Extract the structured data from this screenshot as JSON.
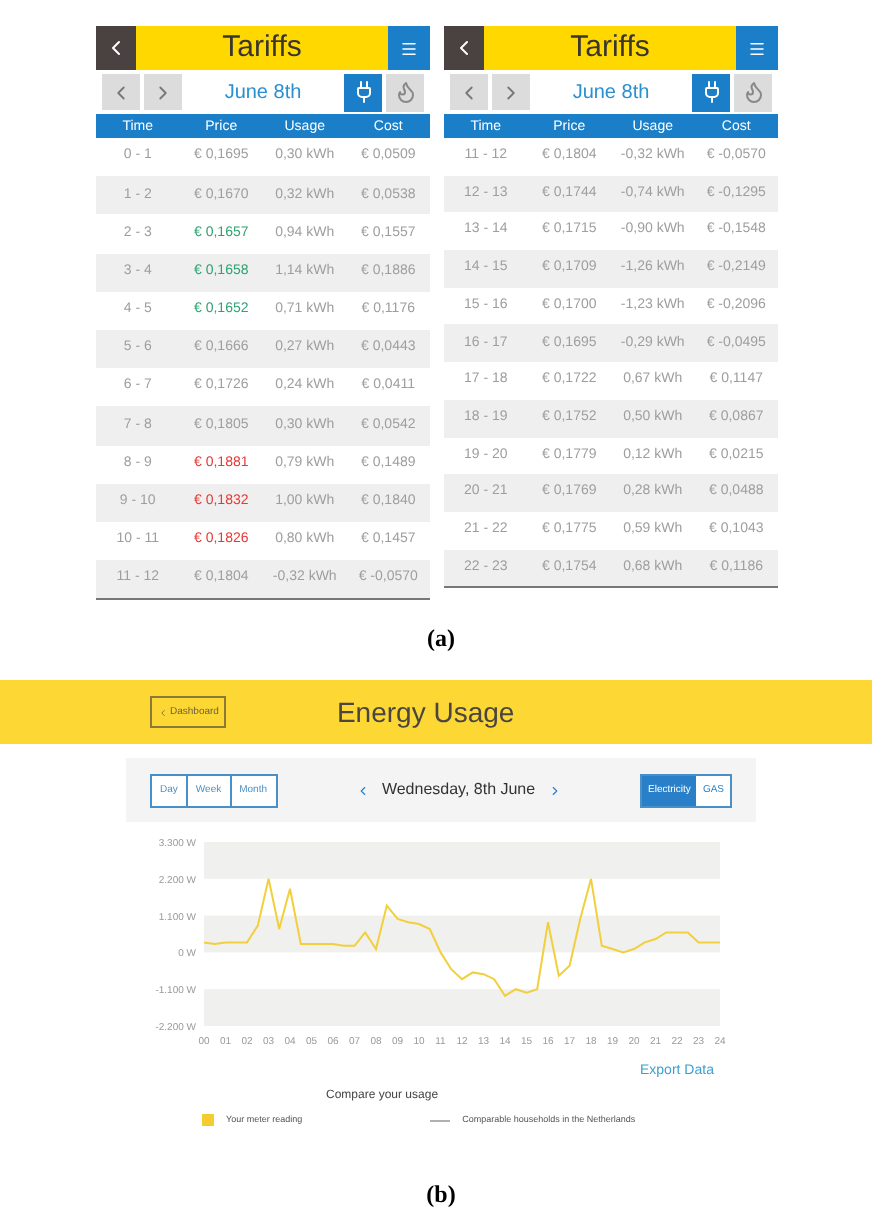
{
  "tariff_screens": [
    {
      "title": "Tariffs",
      "date": "June 8th",
      "energy_buttons": [
        {
          "kind": "electricity",
          "selected": true
        },
        {
          "kind": "gas",
          "selected": false
        }
      ],
      "columns": [
        "Time",
        "Price",
        "Usage",
        "Cost"
      ],
      "rows": [
        {
          "time": "0 - 1",
          "price": "€ 0,1695",
          "usage": "0,30 kWh",
          "cost": "€ 0,0509",
          "color": "#9e9e9e"
        },
        {
          "time": "1 - 2",
          "price": "€ 0,1670",
          "usage": "0,32 kWh",
          "cost": "€ 0,0538",
          "color": "#9e9e9e"
        },
        {
          "time": "2 - 3",
          "price": "€ 0,1657",
          "usage": "0,94 kWh",
          "cost": "€ 0,1557",
          "color": "#2ea371"
        },
        {
          "time": "3 - 4",
          "price": "€ 0,1658",
          "usage": "1,14 kWh",
          "cost": "€ 0,1886",
          "color": "#2ea371"
        },
        {
          "time": "4 - 5",
          "price": "€ 0,1652",
          "usage": "0,71 kWh",
          "cost": "€ 0,1176",
          "color": "#2ea371"
        },
        {
          "time": "5 - 6",
          "price": "€ 0,1666",
          "usage": "0,27 kWh",
          "cost": "€ 0,0443",
          "color": "#9e9e9e"
        },
        {
          "time": "6 - 7",
          "price": "€ 0,1726",
          "usage": "0,24 kWh",
          "cost": "€ 0,0411",
          "color": "#9e9e9e"
        },
        {
          "time": "7 - 8",
          "price": "€ 0,1805",
          "usage": "0,30 kWh",
          "cost": "€ 0,0542",
          "color": "#9e9e9e"
        },
        {
          "time": "8 - 9",
          "price": "€ 0,1881",
          "usage": "0,79 kWh",
          "cost": "€ 0,1489",
          "color": "#e53935"
        },
        {
          "time": "9 - 10",
          "price": "€ 0,1832",
          "usage": "1,00 kWh",
          "cost": "€ 0,1840",
          "color": "#e53935"
        },
        {
          "time": "10 - 11",
          "price": "€ 0,1826",
          "usage": "0,80 kWh",
          "cost": "€ 0,1457",
          "color": "#e53935"
        },
        {
          "time": "11 - 12",
          "price": "€ 0,1804",
          "usage": "-0,32 kWh",
          "cost": "€ -0,0570",
          "color": "#9e9e9e"
        }
      ]
    },
    {
      "title": "Tariffs",
      "date": "June 8th",
      "energy_buttons": [
        {
          "kind": "electricity",
          "selected": true
        },
        {
          "kind": "gas",
          "selected": false
        }
      ],
      "columns": [
        "Time",
        "Price",
        "Usage",
        "Cost"
      ],
      "rows": [
        {
          "time": "11 - 12",
          "price": "€ 0,1804",
          "usage": "-0,32 kWh",
          "cost": "€ -0,0570",
          "color": "#9e9e9e"
        },
        {
          "time": "12 - 13",
          "price": "€ 0,1744",
          "usage": "-0,74 kWh",
          "cost": "€ -0,1295",
          "color": "#9e9e9e"
        },
        {
          "time": "13 - 14",
          "price": "€ 0,1715",
          "usage": "-0,90 kWh",
          "cost": "€ -0,1548",
          "color": "#9e9e9e"
        },
        {
          "time": "14 - 15",
          "price": "€ 0,1709",
          "usage": "-1,26 kWh",
          "cost": "€ -0,2149",
          "color": "#9e9e9e"
        },
        {
          "time": "15 - 16",
          "price": "€ 0,1700",
          "usage": "-1,23 kWh",
          "cost": "€ -0,2096",
          "color": "#9e9e9e"
        },
        {
          "time": "16 - 17",
          "price": "€ 0,1695",
          "usage": "-0,29 kWh",
          "cost": "€ -0,0495",
          "color": "#9e9e9e"
        },
        {
          "time": "17 - 18",
          "price": "€ 0,1722",
          "usage": "0,67 kWh",
          "cost": "€ 0,1147",
          "color": "#9e9e9e"
        },
        {
          "time": "18 - 19",
          "price": "€ 0,1752",
          "usage": "0,50 kWh",
          "cost": "€ 0,0867",
          "color": "#9e9e9e"
        },
        {
          "time": "19 - 20",
          "price": "€ 0,1779",
          "usage": "0,12 kWh",
          "cost": "€ 0,0215",
          "color": "#9e9e9e"
        },
        {
          "time": "20 - 21",
          "price": "€ 0,1769",
          "usage": "0,28 kWh",
          "cost": "€ 0,0488",
          "color": "#9e9e9e"
        },
        {
          "time": "21 - 22",
          "price": "€ 0,1775",
          "usage": "0,59 kWh",
          "cost": "€ 0,1043",
          "color": "#9e9e9e"
        },
        {
          "time": "22 - 23",
          "price": "€ 0,1754",
          "usage": "0,68 kWh",
          "cost": "€ 0,1186",
          "color": "#9e9e9e"
        }
      ]
    }
  ],
  "caption_a": "(a)",
  "energy_usage": {
    "back_button": "Dashboard",
    "title": "Energy Usage",
    "period_tabs": [
      {
        "label": "Day",
        "selected": false
      },
      {
        "label": "Week",
        "selected": false
      },
      {
        "label": "Month",
        "selected": false
      }
    ],
    "date": "Wednesday, 8th June",
    "energy_tabs": [
      {
        "label": "Electricity",
        "selected": true
      },
      {
        "label": "GAS",
        "selected": false
      }
    ],
    "chart_data": {
      "type": "line",
      "x": [
        0,
        0.5,
        1,
        1.5,
        2,
        2.5,
        3,
        3.5,
        4,
        4.5,
        5,
        5.5,
        6,
        6.5,
        7,
        7.5,
        8,
        8.5,
        9,
        9.5,
        10,
        10.5,
        11,
        11.5,
        12,
        12.5,
        13,
        13.5,
        14,
        14.5,
        15,
        15.5,
        16,
        16.5,
        17,
        17.5,
        18,
        18.5,
        19,
        19.5,
        20,
        20.5,
        21,
        21.5,
        22,
        22.5,
        23,
        23.5,
        24
      ],
      "series": [
        {
          "name": "Your meter reading",
          "color": "#f2cf3c",
          "values": [
            300,
            250,
            300,
            300,
            300,
            800,
            2200,
            700,
            1900,
            250,
            250,
            250,
            250,
            200,
            200,
            600,
            100,
            1400,
            1000,
            900,
            850,
            700,
            0,
            -500,
            -800,
            -600,
            -650,
            -800,
            -1300,
            -1100,
            -1200,
            -1100,
            900,
            -700,
            -400,
            1000,
            2200,
            200,
            100,
            0,
            100,
            300,
            400,
            600,
            600,
            600,
            300,
            300,
            300
          ]
        }
      ],
      "xlim": [
        0,
        24
      ],
      "ylim": [
        -2200,
        3300
      ],
      "xticks": [
        {
          "value": 0,
          "label": "00"
        },
        {
          "value": 1,
          "label": "01"
        },
        {
          "value": 2,
          "label": "02"
        },
        {
          "value": 3,
          "label": "03"
        },
        {
          "value": 4,
          "label": "04"
        },
        {
          "value": 5,
          "label": "05"
        },
        {
          "value": 6,
          "label": "06"
        },
        {
          "value": 7,
          "label": "07"
        },
        {
          "value": 8,
          "label": "08"
        },
        {
          "value": 9,
          "label": "09"
        },
        {
          "value": 10,
          "label": "10"
        },
        {
          "value": 11,
          "label": "11"
        },
        {
          "value": 12,
          "label": "12"
        },
        {
          "value": 13,
          "label": "13"
        },
        {
          "value": 14,
          "label": "14"
        },
        {
          "value": 15,
          "label": "15"
        },
        {
          "value": 16,
          "label": "16"
        },
        {
          "value": 17,
          "label": "17"
        },
        {
          "value": 18,
          "label": "18"
        },
        {
          "value": 19,
          "label": "19"
        },
        {
          "value": 20,
          "label": "20"
        },
        {
          "value": 21,
          "label": "21"
        },
        {
          "value": 22,
          "label": "22"
        },
        {
          "value": 23,
          "label": "23"
        },
        {
          "value": 24,
          "label": "24"
        }
      ],
      "yticks": [
        {
          "value": 3300,
          "label": "3.300 W"
        },
        {
          "value": 2200,
          "label": "2.200 W"
        },
        {
          "value": 1100,
          "label": "1.100 W"
        },
        {
          "value": 0,
          "label": "0 W"
        },
        {
          "value": -1100,
          "label": "-1.100 W"
        },
        {
          "value": -2200,
          "label": "-2.200 W"
        }
      ]
    },
    "export_link": "Export Data",
    "compare_heading": "Compare your usage",
    "legend": [
      {
        "kind": "swatch",
        "color": "#f7cd2e"
      },
      {
        "kind": "line",
        "label": "Comparable households in the Netherlands",
        "color": "#b0b0b0"
      }
    ]
  },
  "caption_b": "(b)"
}
